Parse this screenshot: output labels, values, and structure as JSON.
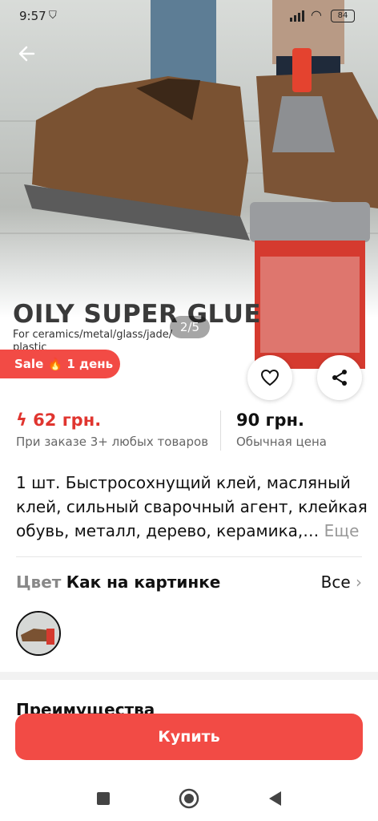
{
  "status_bar": {
    "time": "9:57",
    "battery": "84"
  },
  "gallery": {
    "pager": "2/5"
  },
  "product_image": {
    "title": "OILY SUPER GLUE",
    "subtitle": "For ceramics/metal/glass/jade/\nplastic"
  },
  "sale_badge": {
    "text": "Sale 🔥 1 день"
  },
  "prices": {
    "discount_price": "62 грн.",
    "discount_note": "При заказе 3+ любых товаров",
    "regular_price": "90 грн.",
    "regular_note": "Обычная цена"
  },
  "description": {
    "text": "1 шт. Быстросохнущий клей, масляный клей, сильный сварочный агент, клейкая обувь, металл, дерево, керамика,…",
    "more": "Еще"
  },
  "color": {
    "label": "Цвет",
    "value": "Как на картинке",
    "all": "Все"
  },
  "section": {
    "title": "Преимущества"
  },
  "buy_button": {
    "label": "Купить"
  },
  "colors": {
    "accent": "#f24b45",
    "price": "#e0352f"
  },
  "icons": [
    "back-arrow-icon",
    "heart-icon",
    "share-icon",
    "chevron-right-icon",
    "nav-square-icon",
    "nav-circle-icon",
    "nav-back-icon"
  ]
}
